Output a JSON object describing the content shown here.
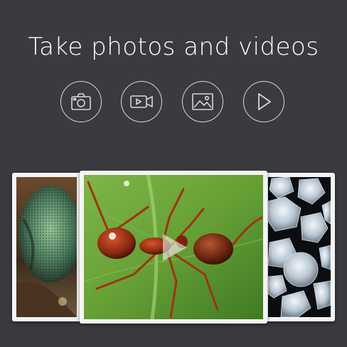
{
  "header": {
    "title": "Take photos and videos"
  },
  "actions": [
    {
      "id": "camera",
      "icon": "camera-icon"
    },
    {
      "id": "video",
      "icon": "video-camera-icon"
    },
    {
      "id": "gallery",
      "icon": "image-gallery-icon"
    },
    {
      "id": "play",
      "icon": "play-icon"
    }
  ],
  "gallery": {
    "items": [
      {
        "subject": "insect-compound-eye"
      },
      {
        "subject": "red-ant-on-leaf"
      },
      {
        "subject": "salt-crystals"
      }
    ]
  },
  "colors": {
    "background": "#3a3b3f",
    "icon_stroke": "#d8d8d8",
    "card_frame": "#f4f4f4",
    "leaf_green": "#6fa53a",
    "ant_red": "#8a2a12"
  }
}
